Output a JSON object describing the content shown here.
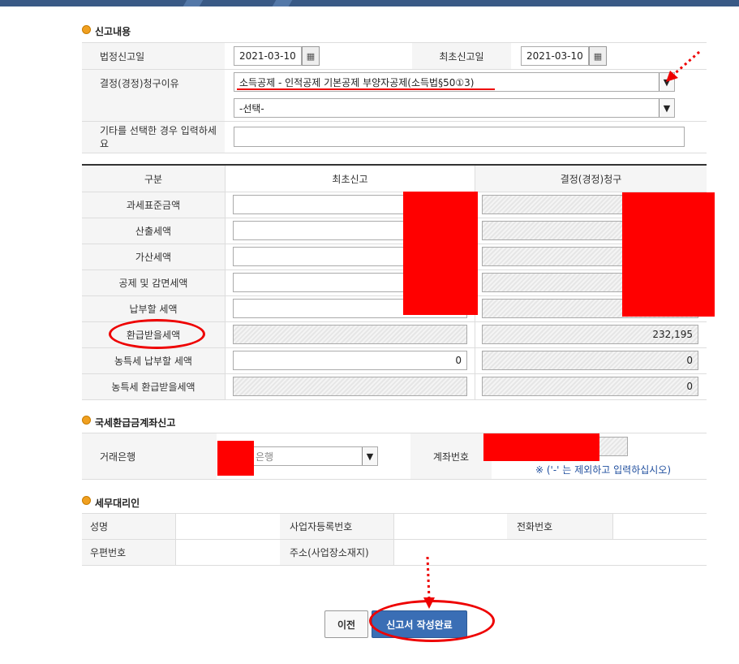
{
  "report": {
    "section_title": "신고내용",
    "statutory_date_label": "법정신고일",
    "statutory_date_value": "2021-03-10",
    "initial_date_label": "최초신고일",
    "initial_date_value": "2021-03-10",
    "calendar_icon": "calendar-icon",
    "reason_label": "결정(경정)청구이유",
    "reason_value": "소득공제 - 인적공제 기본공제 부양자공제(소득법§50①3)",
    "reason2_value": "-선택-",
    "other_label": "기타를 선택한 경우 입력하세요",
    "other_value": ""
  },
  "amounts": {
    "header_category": "구분",
    "header_initial": "최초신고",
    "header_claim": "결정(경정)청구",
    "rows": [
      {
        "label": "과세표준금액",
        "initial": "",
        "claim": ""
      },
      {
        "label": "산출세액",
        "initial": "",
        "claim": ""
      },
      {
        "label": "가산세액",
        "initial": "",
        "claim": ""
      },
      {
        "label": "공제 및 감면세액",
        "initial": "",
        "claim": ""
      },
      {
        "label": "납부할 세액",
        "initial": "",
        "claim": ""
      },
      {
        "label": "환급받을세액",
        "initial": "",
        "claim": "232,195"
      },
      {
        "label": "농특세 납부할 세액",
        "initial": "0",
        "claim": "0"
      },
      {
        "label": "농특세 환급받을세액",
        "initial": "",
        "claim": "0"
      }
    ]
  },
  "refund": {
    "section_title": "국세환급금계좌신고",
    "bank_label": "거래은행",
    "bank_value": "은행",
    "account_label": "계좌번호",
    "account_value": "",
    "note": "※ ('-' 는 제외하고 입력하십시오)"
  },
  "agent": {
    "section_title": "세무대리인",
    "name_label": "성명",
    "bizno_label": "사업자등록번호",
    "phone_label": "전화번호",
    "zip_label": "우편번호",
    "address_label": "주소(사업장소재지)"
  },
  "buttons": {
    "prev": "이전",
    "complete": "신고서 작성완료"
  },
  "colors": {
    "accent": "#3a6eb5",
    "redaction": "#ff0000",
    "annotation": "#e00000"
  }
}
